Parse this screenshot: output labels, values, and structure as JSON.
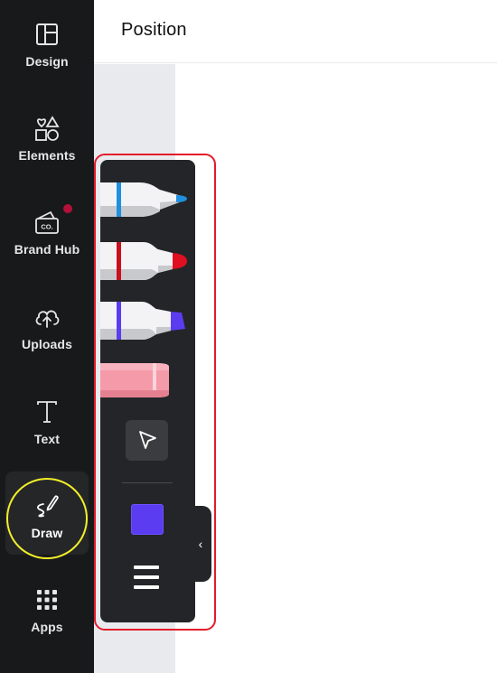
{
  "topbar": {
    "position_label": "Position"
  },
  "sidebar": {
    "items": [
      {
        "label": "Design",
        "icon": "layout-icon"
      },
      {
        "label": "Elements",
        "icon": "shapes-icon"
      },
      {
        "label": "Brand Hub",
        "icon": "brand-kit-icon",
        "icon_text": "CO."
      },
      {
        "label": "Uploads",
        "icon": "cloud-upload-icon"
      },
      {
        "label": "Text",
        "icon": "text-icon"
      },
      {
        "label": "Draw",
        "icon": "draw-icon",
        "active": true
      },
      {
        "label": "Apps",
        "icon": "apps-grid-icon"
      }
    ],
    "notification_color": "#b3103a"
  },
  "draw_toolbar": {
    "tools": [
      {
        "name": "Pen",
        "tip_color": "#1f8fe0",
        "band_color": "#1f8fe0"
      },
      {
        "name": "Marker",
        "tip_color": "#e01020",
        "band_color": "#c8101e"
      },
      {
        "name": "Highlighter",
        "tip_color": "#5b3cf0",
        "band_color": "#5b3cf0"
      },
      {
        "name": "Eraser",
        "color": "#f59aa8"
      }
    ],
    "selected_color": "#5c3cf0",
    "collapse_glyph": "‹"
  },
  "annotations": {
    "highlight_circle_color": "#f2ee2b",
    "outline_color": "#e31b2b"
  }
}
